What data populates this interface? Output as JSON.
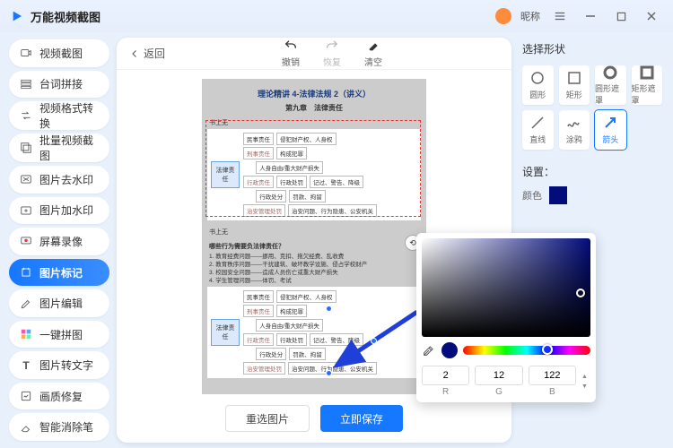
{
  "app": {
    "title": "万能视频截图",
    "nickname": "昵称"
  },
  "sidebar": {
    "items": [
      {
        "label": "视频截图"
      },
      {
        "label": "台词拼接"
      },
      {
        "label": "视频格式转换"
      },
      {
        "label": "批量视频截图"
      },
      {
        "label": "图片去水印"
      },
      {
        "label": "图片加水印"
      },
      {
        "label": "屏幕录像"
      },
      {
        "label": "图片标记"
      },
      {
        "label": "图片编辑"
      },
      {
        "label": "一键拼图"
      },
      {
        "label": "图片转文字"
      },
      {
        "label": "画质修复"
      },
      {
        "label": "智能消除笔"
      }
    ]
  },
  "editor": {
    "back": "返回",
    "tools": {
      "undo": "撤销",
      "redo": "恢复",
      "clear": "清空"
    },
    "buttons": {
      "reselect": "重选图片",
      "save": "立即保存"
    }
  },
  "doc": {
    "title": "理论精讲 4-法律法规 2（讲义）",
    "chapter": "第九章　法律责任",
    "section": "书上无",
    "root": "法律责任",
    "rows": [
      {
        "a": "民事责任",
        "b": "侵犯财产权、人身权"
      },
      {
        "a": "刑事责任",
        "b1": "构成犯罪",
        "b2": "人身自由/重大财产损失"
      },
      {
        "a": "行政责任",
        "b1": "行政处罚",
        "b2": "记过、警告、降级"
      },
      {
        "a": "",
        "b1": "行政处分",
        "b2": "罚款、拘留"
      },
      {
        "a": "治安管理处罚",
        "b": "治安问题、行为隐患、公安机关"
      }
    ],
    "notes_title": "哪些行为需要负法律责任？",
    "notes": [
      "1. 教育经费问题——挪用、克扣、拖欠经费、乱收费",
      "2. 教育秩序问题——干扰建筑、破坏教学设施、侵占学校财产",
      "3. 校园安全问题——造成人员伤亡或重大财产损失",
      "4. 学生管理问题——体罚、考试"
    ]
  },
  "right": {
    "title": "选择形状",
    "shapes": [
      {
        "label": "圆形"
      },
      {
        "label": "矩形"
      },
      {
        "label": "圆形遮罩"
      },
      {
        "label": "矩形遮罩"
      },
      {
        "label": "直线"
      },
      {
        "label": "涂鸦"
      },
      {
        "label": "箭头"
      }
    ],
    "settings": "设置：",
    "color_label": "颜色"
  },
  "picker": {
    "r": "2",
    "g": "12",
    "b": "122",
    "labels": {
      "r": "R",
      "g": "G",
      "b": "B"
    }
  }
}
